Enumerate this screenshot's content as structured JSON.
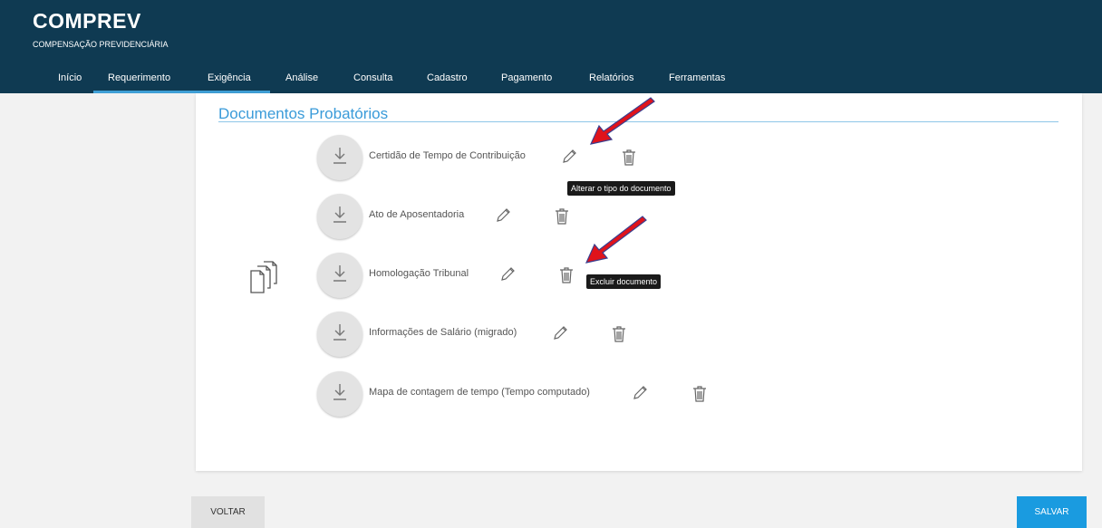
{
  "app": {
    "title": "COMPREV",
    "subtitle": "COMPENSAÇÃO PREVIDENCIÁRIA",
    "brand_color": "#0f3a52",
    "accent_color": "#3a9bd9"
  },
  "nav": {
    "items": [
      {
        "label": "Início"
      },
      {
        "label": "Requerimento"
      },
      {
        "label": "Exigência"
      },
      {
        "label": "Análise"
      },
      {
        "label": "Consulta"
      },
      {
        "label": "Cadastro"
      },
      {
        "label": "Pagamento"
      },
      {
        "label": "Relatórios"
      },
      {
        "label": "Ferramentas"
      }
    ],
    "active": "Exigência"
  },
  "section": {
    "title": "Documentos Probatórios"
  },
  "documents": [
    {
      "name": "Certidão de Tempo de Contribuição",
      "icons": [
        "download-icon",
        "pencil-icon",
        "trash-icon"
      ]
    },
    {
      "name": "Ato de Aposentadoria",
      "icons": [
        "download-icon",
        "pencil-icon",
        "trash-icon"
      ]
    },
    {
      "name": "Homologação Tribunal",
      "icons": [
        "download-icon",
        "pencil-icon",
        "trash-icon"
      ]
    },
    {
      "name": "Informações de Salário (migrado)",
      "icons": [
        "download-icon",
        "pencil-icon",
        "trash-icon"
      ]
    },
    {
      "name": "Mapa de contagem de tempo (Tempo computado)",
      "icons": [
        "download-icon",
        "pencil-icon",
        "trash-icon"
      ]
    }
  ],
  "tooltips": {
    "edit": "Alterar o tipo do documento",
    "delete": "Excluir documento"
  },
  "buttons": {
    "back": "VOLTAR",
    "save": "SALVAR",
    "save_color": "#1a9be0"
  },
  "annotation_color": "#e0131b"
}
